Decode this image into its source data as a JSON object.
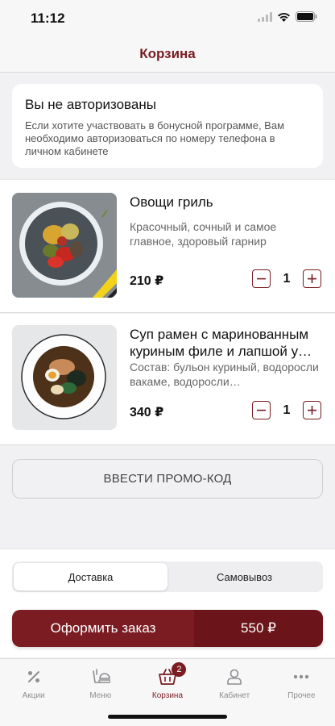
{
  "status": {
    "time": "11:12"
  },
  "nav": {
    "title": "Корзина"
  },
  "auth": {
    "title": "Вы не авторизованы",
    "text": "Если хотите участвовать в бонусной программе, Вам необходимо авторизоваться по номеру телефона в личном кабинете"
  },
  "products": [
    {
      "name": "Овощи гриль",
      "description": "Красочный, сочный и самое главное, здоровый гарнир",
      "price": "210 ₽",
      "quantity": "1"
    },
    {
      "name": "Суп рамен с маринованным куриным филе и лапшой у…",
      "description": "Состав: бульон куриный, водоросли вакаме, водоросли…",
      "price": "340 ₽",
      "quantity": "1"
    }
  ],
  "promo": {
    "label": "ВВЕСТИ ПРОМО-КОД"
  },
  "delivery": {
    "options": [
      "Доставка",
      "Самовывоз"
    ],
    "selected": "Доставка"
  },
  "order": {
    "label": "Оформить заказ",
    "total": "550 ₽"
  },
  "tabs": [
    {
      "label": "Акции",
      "icon": "percent-icon"
    },
    {
      "label": "Меню",
      "icon": "menu-dish-icon"
    },
    {
      "label": "Корзина",
      "icon": "basket-icon",
      "badge": "2",
      "active": true
    },
    {
      "label": "Кабинет",
      "icon": "user-icon"
    },
    {
      "label": "Прочее",
      "icon": "more-icon"
    }
  ],
  "colors": {
    "accent": "#7a1c22",
    "accent_dark": "#6b1419"
  }
}
